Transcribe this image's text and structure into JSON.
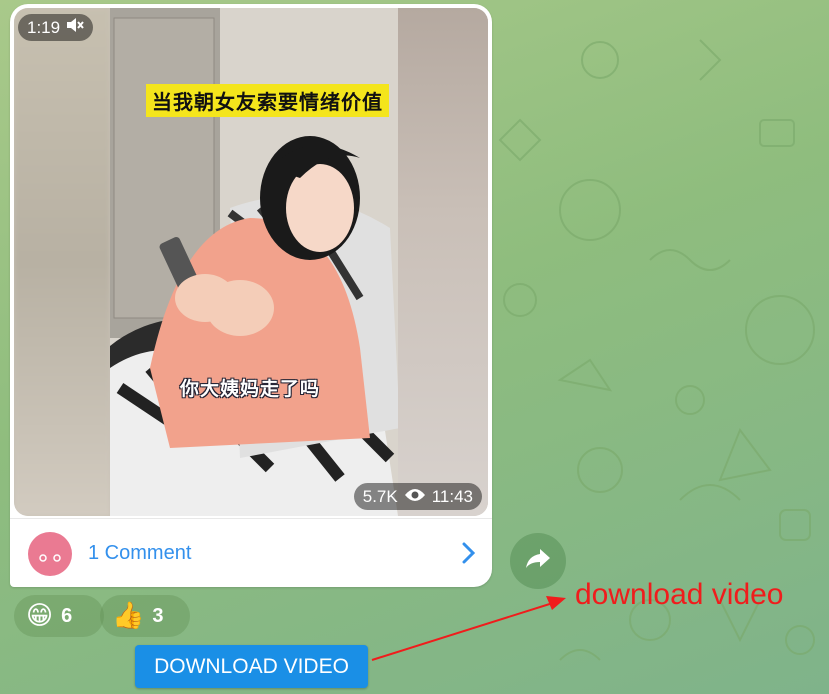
{
  "video": {
    "duration": "1:19",
    "muted_icon": "speaker-muted-icon",
    "caption_top": "当我朝女友索要情绪价值",
    "caption_sub": "你大姨妈走了吗",
    "views": "5.7K",
    "time": "11:43"
  },
  "comments": {
    "label": "1 Comment"
  },
  "reactions": [
    {
      "emoji": "😁",
      "count": "6"
    },
    {
      "emoji": "👍",
      "count": "3"
    }
  ],
  "download_button": {
    "label": "DOWNLOAD VIDEO"
  },
  "annotation": {
    "text": "download video",
    "color": "#f01c1c"
  },
  "colors": {
    "accent": "#3390ec",
    "button": "#1a8fe6",
    "background": "#8fbd7e"
  }
}
